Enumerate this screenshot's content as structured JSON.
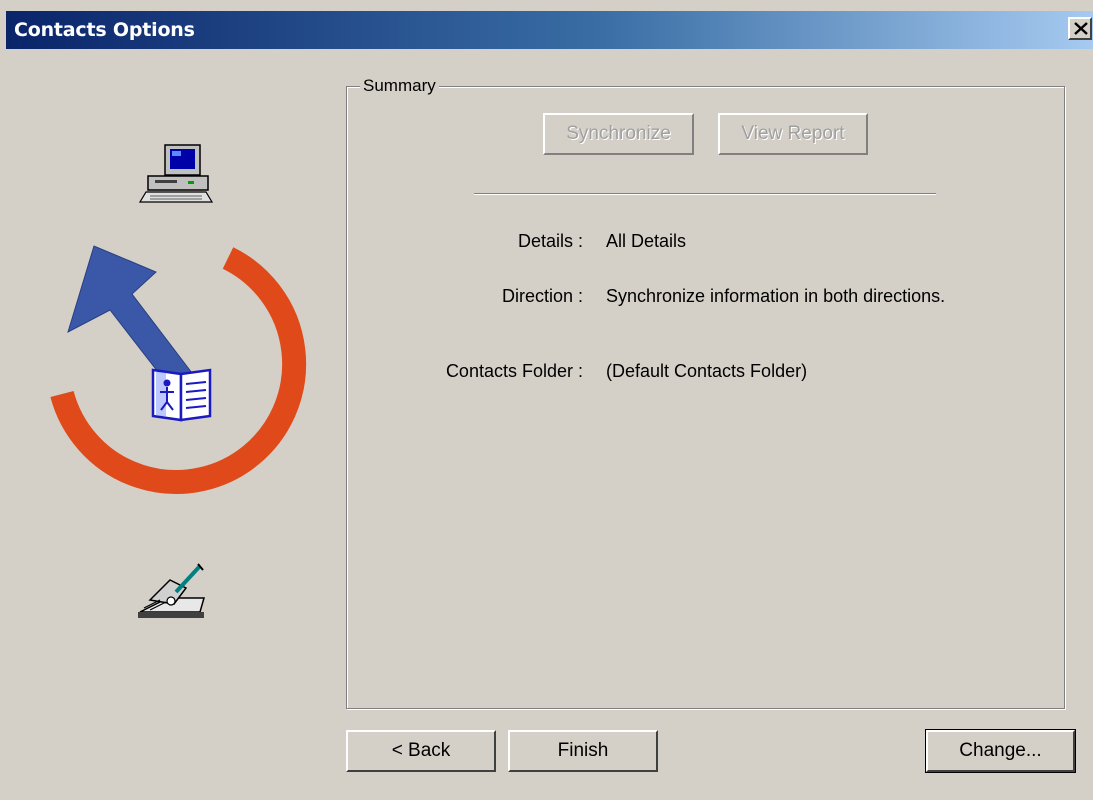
{
  "window": {
    "title": "Contacts Options",
    "close_label": "×"
  },
  "summary": {
    "group_label": "Summary",
    "synchronize_label": "Synchronize",
    "view_report_label": "View Report",
    "fields": [
      {
        "label": "Details :",
        "value": "All Details"
      },
      {
        "label": "Direction :",
        "value": "Synchronize information in both directions."
      },
      {
        "label": "Contacts Folder :",
        "value": "(Default Contacts Folder)"
      }
    ]
  },
  "footer": {
    "back_label": "< Back",
    "finish_label": "Finish",
    "change_label": "Change..."
  },
  "icons": {
    "computer": "computer-icon",
    "arrow": "sync-arrow-icon",
    "address_book": "address-book-icon",
    "pda": "pda-icon"
  },
  "colors": {
    "titlebar_start": "#0a246a",
    "titlebar_end": "#a6caf0",
    "sync_ring": "#e04a1a",
    "sync_arrow": "#3a57a8",
    "face": "#d4d0c8"
  }
}
